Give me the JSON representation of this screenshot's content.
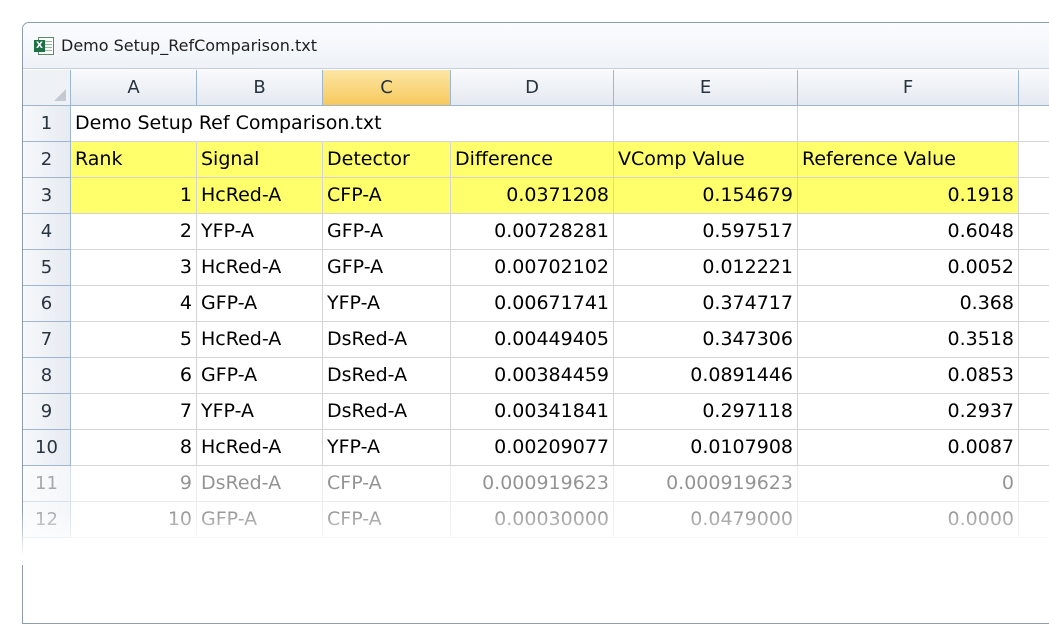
{
  "window": {
    "title": "Demo Setup_RefComparison.txt",
    "app_icon": "excel-icon"
  },
  "columns": [
    "A",
    "B",
    "C",
    "D",
    "E",
    "F"
  ],
  "selected_column": "C",
  "rows": [
    {
      "n": "1",
      "cells": [
        "Demo Setup Ref Comparison.txt",
        "",
        "",
        "",
        "",
        ""
      ]
    },
    {
      "n": "2",
      "highlight": true,
      "cells": [
        "Rank",
        "Signal",
        "Detector",
        "Difference",
        "VComp Value",
        "Reference Value"
      ]
    },
    {
      "n": "3",
      "highlight": true,
      "cells": [
        "1",
        "HcRed-A",
        "CFP-A",
        "0.0371208",
        "0.154679",
        "0.1918"
      ]
    },
    {
      "n": "4",
      "cells": [
        "2",
        "YFP-A",
        "GFP-A",
        "0.00728281",
        "0.597517",
        "0.6048"
      ]
    },
    {
      "n": "5",
      "cells": [
        "3",
        "HcRed-A",
        "GFP-A",
        "0.00702102",
        "0.012221",
        "0.0052"
      ]
    },
    {
      "n": "6",
      "cells": [
        "4",
        "GFP-A",
        "YFP-A",
        "0.00671741",
        "0.374717",
        "0.368"
      ]
    },
    {
      "n": "7",
      "cells": [
        "5",
        "HcRed-A",
        "DsRed-A",
        "0.00449405",
        "0.347306",
        "0.3518"
      ]
    },
    {
      "n": "8",
      "cells": [
        "6",
        "GFP-A",
        "DsRed-A",
        "0.00384459",
        "0.0891446",
        "0.0853"
      ]
    },
    {
      "n": "9",
      "cells": [
        "7",
        "YFP-A",
        "DsRed-A",
        "0.00341841",
        "0.297118",
        "0.2937"
      ]
    },
    {
      "n": "10",
      "cells": [
        "8",
        "HcRed-A",
        "YFP-A",
        "0.00209077",
        "0.0107908",
        "0.0087"
      ]
    },
    {
      "n": "11",
      "faded": true,
      "cells": [
        "9",
        "DsRed-A",
        "CFP-A",
        "0.000919623",
        "0.000919623",
        "0"
      ]
    },
    {
      "n": "12",
      "faded": true,
      "cells": [
        "10",
        "GFP-A",
        "CFP-A",
        "0.00030000",
        "0.0479000",
        "0.0000"
      ]
    }
  ],
  "colors": {
    "highlight": "#ffff6b",
    "selected_header": "#f7c95c"
  }
}
